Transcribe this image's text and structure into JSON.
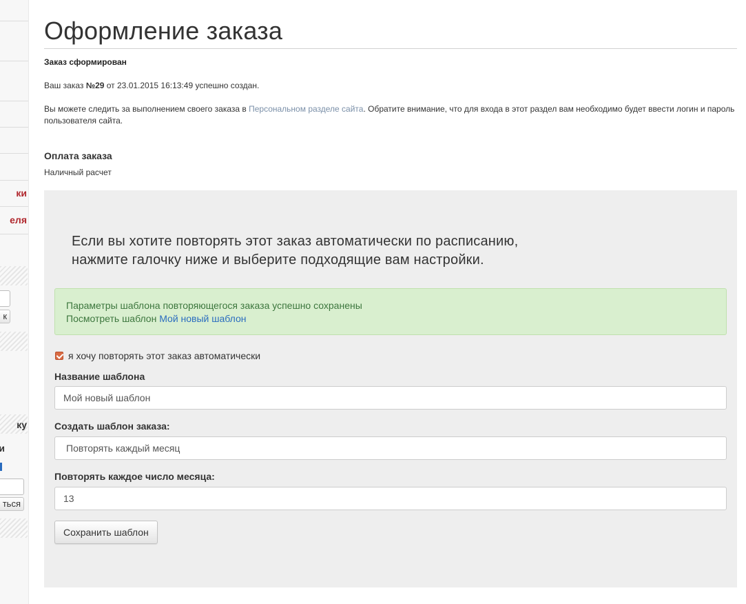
{
  "sidebar": {
    "red_link_1": "ки",
    "red_link_2": "еля",
    "button_1": "к",
    "text_1": "ку",
    "text_2": "и",
    "blue_text": "",
    "button_2": "ться"
  },
  "page": {
    "title": "Оформление заказа",
    "status": "Заказ сформирован",
    "order_prefix": "Ваш заказ ",
    "order_number": "№29",
    "order_suffix": " от 23.01.2015 16:13:49 успешно создан.",
    "info_before": "Вы можете следить за выполнением своего заказа в ",
    "info_link": "Персональном разделе сайта",
    "info_after": ". Обратите внимание, что для входа в этот раздел вам необходимо будет ввести логин и пароль пользователя сайта."
  },
  "payment": {
    "heading": "Оплата заказа",
    "method": "Наличный расчет"
  },
  "repeat": {
    "lead_line1": "Если вы хотите повторять этот заказ автоматически по расписанию,",
    "lead_line2": "нажмите галочку ниже и выберите подходящие вам настройки.",
    "alert_line1": "Параметры шаблона повторяющегося заказа успешно сохранены",
    "alert_line2_prefix": "Посмотреть шаблон ",
    "alert_link": "Мой новый шаблон",
    "checkbox_label": "я хочу повторять этот заказ автоматически",
    "checkbox_checked": true,
    "template_name_label": "Название шаблона",
    "template_name_value": "Мой новый шаблон",
    "schedule_label": "Создать шаблон заказа:",
    "schedule_value": "Повторять каждый месяц",
    "day_label": "Повторять каждое число месяца:",
    "day_value": "13",
    "save_button": "Сохранить шаблон"
  },
  "colors": {
    "accent_red": "#b0272d",
    "link": "#2a6cbf",
    "success_bg": "#d9efcf",
    "success_text": "#3c763d",
    "checkbox": "#d96b43"
  }
}
